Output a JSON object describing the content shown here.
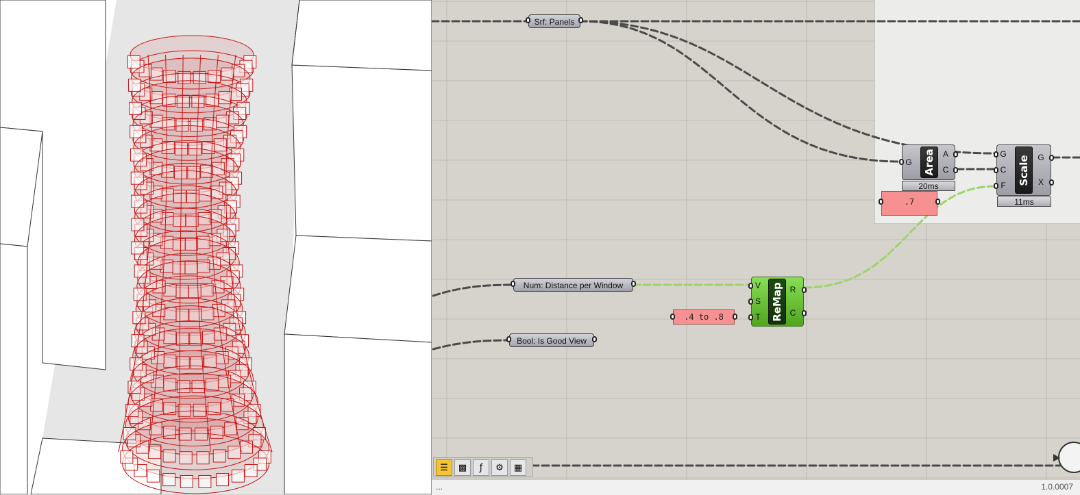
{
  "canvas": {
    "params": {
      "srf_panels": "Srf: Panels",
      "num_distance": "Num: Distance per Window",
      "bool_good_view": "Bool: Is Good View"
    },
    "panels": {
      "area_factor": ".7",
      "remap_range": ".4 to .8"
    },
    "components": {
      "area": {
        "name": "Area",
        "inputs": [
          "G"
        ],
        "outputs": [
          "A",
          "C"
        ],
        "time": "20ms"
      },
      "scale": {
        "name": "Scale",
        "inputs": [
          "G",
          "C",
          "F"
        ],
        "outputs": [
          "G",
          "X"
        ],
        "time": "11ms"
      },
      "remap": {
        "name": "ReMap",
        "inputs": [
          "V",
          "S",
          "T"
        ],
        "outputs": [
          "R",
          "C"
        ]
      }
    },
    "colors": {
      "wire": "#4a4a4a",
      "wire_selected": "#9cd46a",
      "panel": "#f79090",
      "component_green": "#6cc23a"
    }
  },
  "toolbar": {
    "icons": [
      "grasshopper-icon",
      "galapagos-icon",
      "python-icon",
      "kangaroo-icon",
      "ladybug-icon"
    ]
  },
  "statusbar": {
    "left": "...",
    "right": "1.0.0007"
  }
}
